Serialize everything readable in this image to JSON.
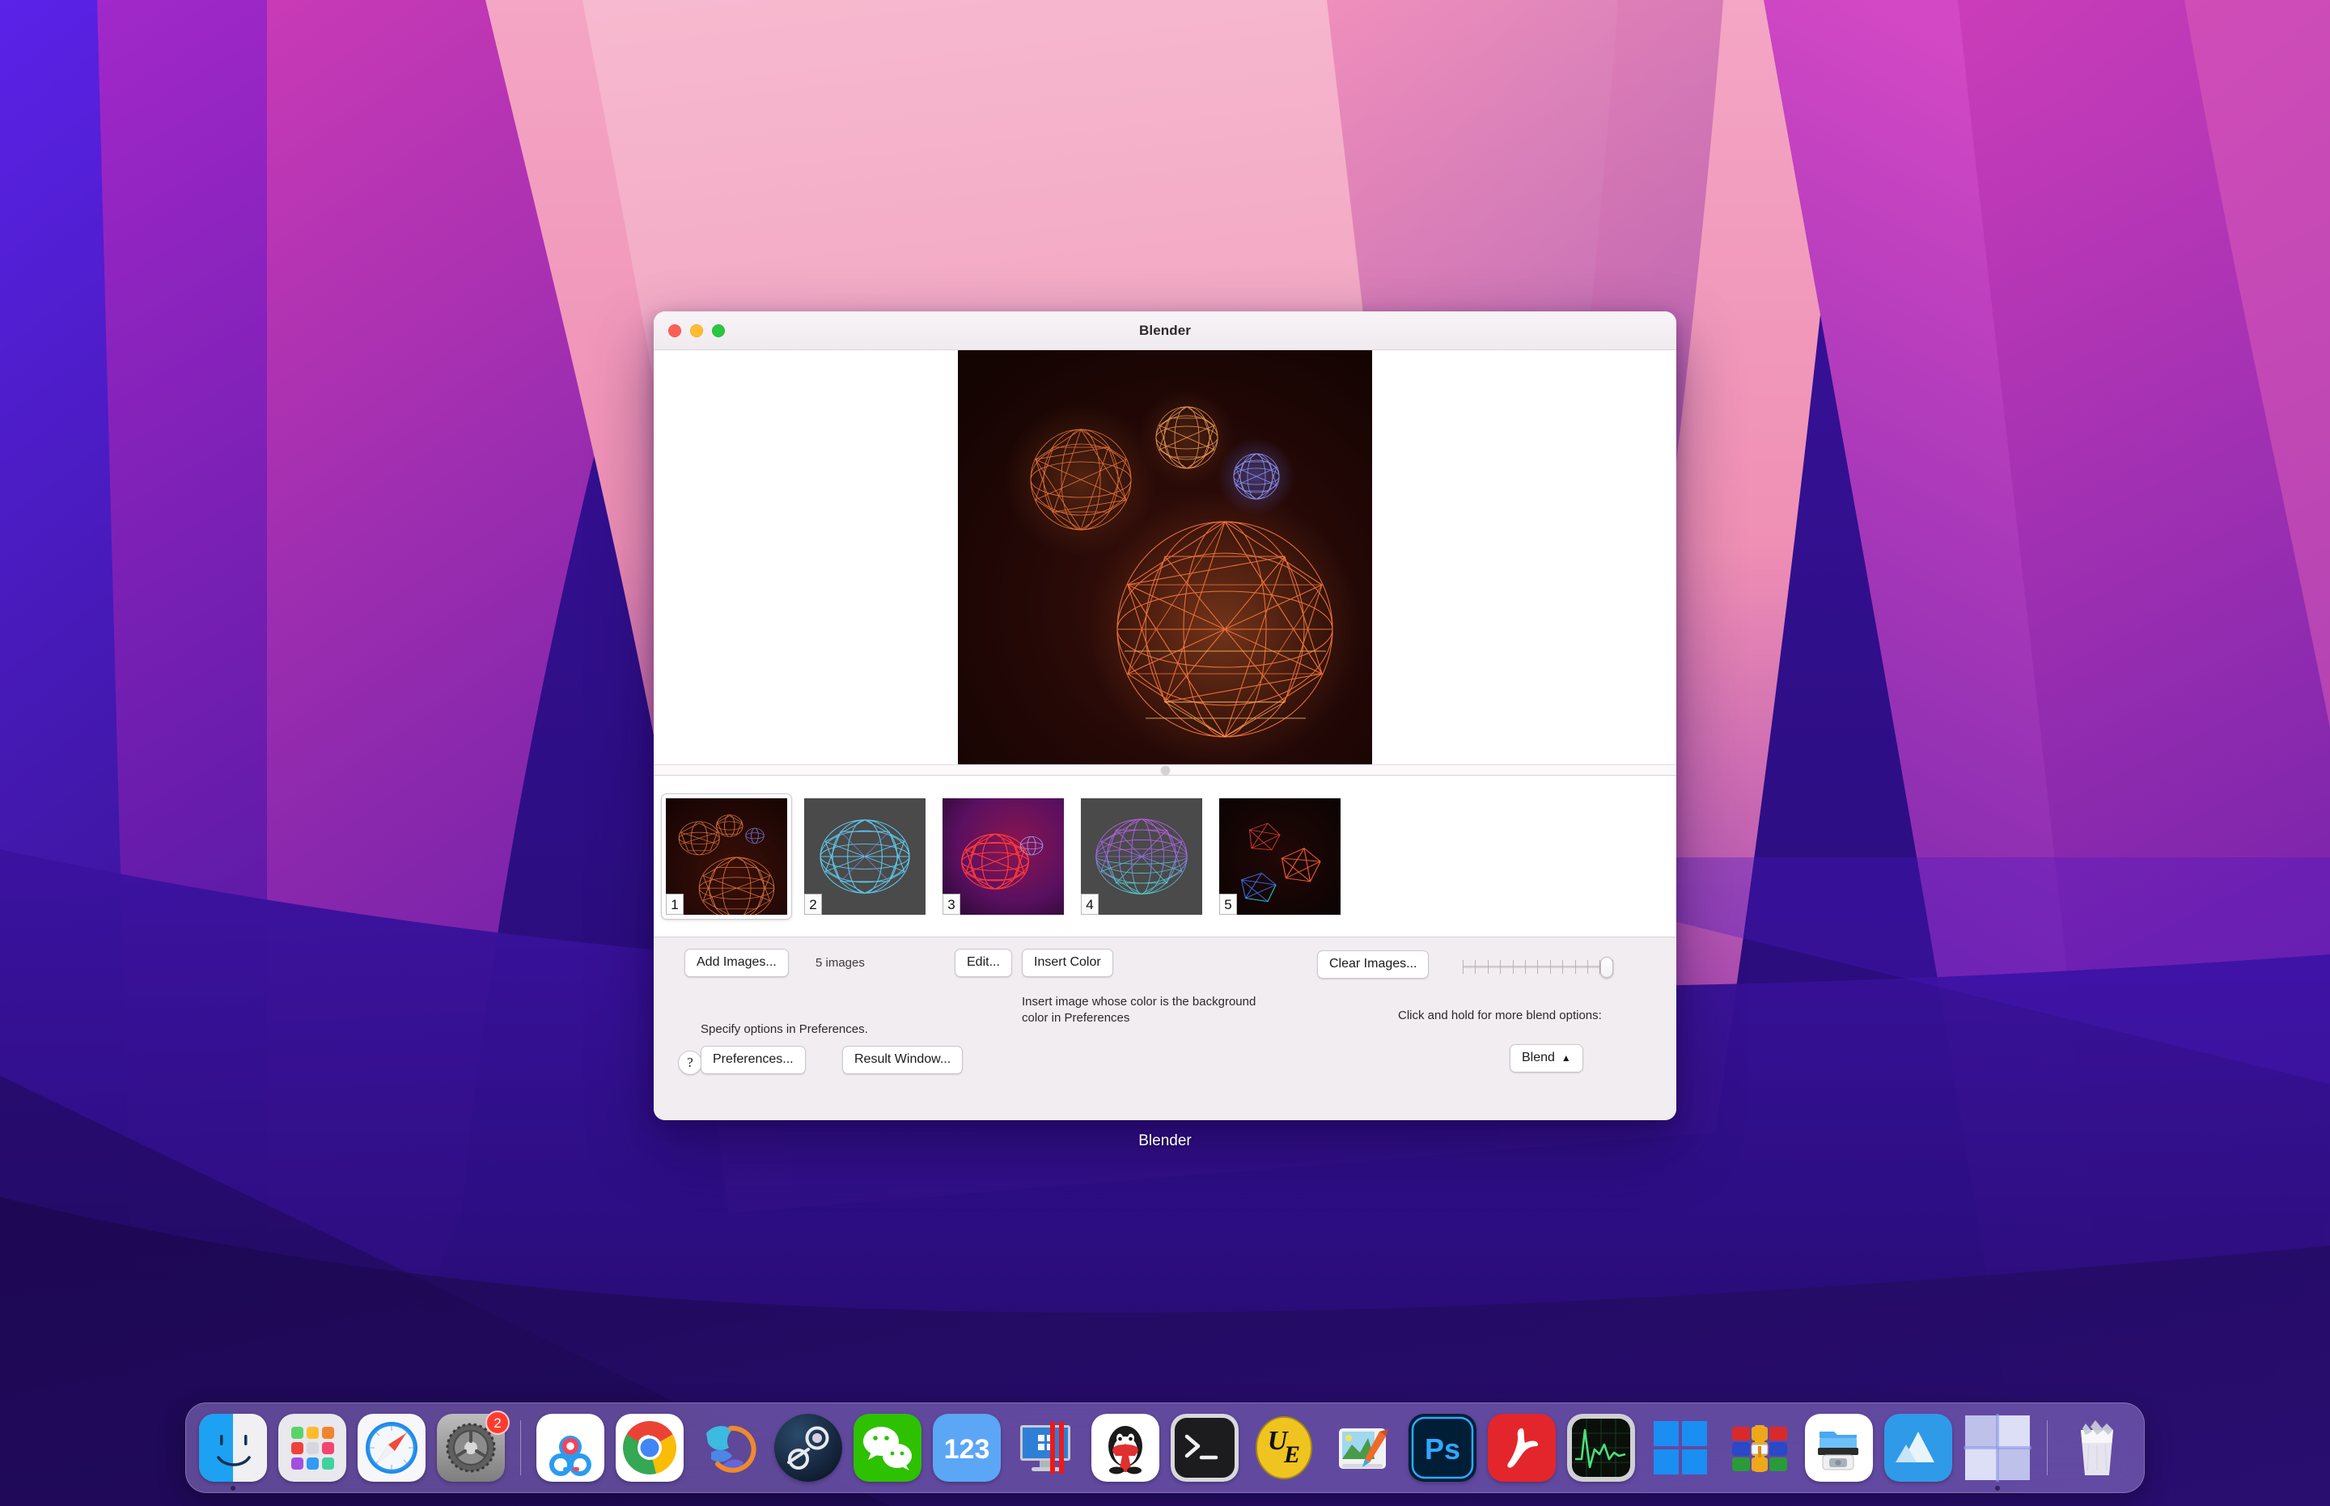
{
  "window": {
    "title": "Blender",
    "label_below": "Blender",
    "traffic_lights": [
      "close-button",
      "minimize-button",
      "zoom-button"
    ]
  },
  "preview": {
    "name": "main-image-preview",
    "description": "Dark red wireframe geodesic spheres render"
  },
  "thumbnails": [
    {
      "badge": "1",
      "selected": true,
      "theme": "dark-red-three-spheres"
    },
    {
      "badge": "2",
      "selected": false,
      "theme": "gray-blue-sphere"
    },
    {
      "badge": "3",
      "selected": false,
      "theme": "magenta-red-sphere"
    },
    {
      "badge": "4",
      "selected": false,
      "theme": "gray-purple-cyan-sphere"
    },
    {
      "badge": "5",
      "selected": false,
      "theme": "black-red-blue-polygons"
    }
  ],
  "controls": {
    "add_images": "Add Images...",
    "image_count": "5 images",
    "edit": "Edit...",
    "insert_color": "Insert Color",
    "insert_color_help": "Insert image whose color is the background color in Preferences",
    "clear_images": "Clear Images...",
    "blend_help": "Click and hold for more blend options:",
    "specify_options": "Specify options in Preferences.",
    "help": "?",
    "preferences": "Preferences...",
    "result_window": "Result Window...",
    "blend": "Blend",
    "blend_caret": "▲",
    "slider_value": 100,
    "slider_ticks": 13
  },
  "dock": {
    "items": [
      {
        "name": "finder",
        "label": "Finder"
      },
      {
        "name": "launchpad",
        "label": "Launchpad"
      },
      {
        "name": "safari",
        "label": "Safari"
      },
      {
        "name": "system-preferences",
        "label": "System Preferences",
        "badge": "2"
      },
      {
        "name": "separator",
        "label": ""
      },
      {
        "name": "baidu-netdisk",
        "label": "Baidu Netdisk"
      },
      {
        "name": "google-chrome",
        "label": "Google Chrome"
      },
      {
        "name": "thunder",
        "label": "Thunder"
      },
      {
        "name": "steam",
        "label": "Steam"
      },
      {
        "name": "wechat",
        "label": "WeChat"
      },
      {
        "name": "123-pan",
        "label": "123 Pan"
      },
      {
        "name": "parallels-desktop",
        "label": "Parallels Desktop"
      },
      {
        "name": "qq",
        "label": "QQ"
      },
      {
        "name": "terminal",
        "label": "Terminal"
      },
      {
        "name": "ultraedit",
        "label": "UltraEdit"
      },
      {
        "name": "paintbrush",
        "label": "Paintbrush"
      },
      {
        "name": "photoshop",
        "label": "Adobe Photoshop"
      },
      {
        "name": "acrobat",
        "label": "Adobe Acrobat"
      },
      {
        "name": "activity-monitor",
        "label": "Activity Monitor"
      },
      {
        "name": "windows",
        "label": "Windows"
      },
      {
        "name": "winrar",
        "label": "WinRAR"
      },
      {
        "name": "scanner",
        "label": "Scanner"
      },
      {
        "name": "mountain",
        "label": "Mountain"
      },
      {
        "name": "blender",
        "label": "Blender",
        "running": true
      },
      {
        "name": "separator2",
        "label": ""
      },
      {
        "name": "trash",
        "label": "Trash"
      }
    ]
  },
  "colors": {
    "accent": "#f0ebee",
    "window_bg": "#f2eef1",
    "badge_red": "#ff3b30",
    "tl_red": "#ff5f57",
    "tl_yellow": "#febc2e",
    "tl_green": "#28c840"
  }
}
